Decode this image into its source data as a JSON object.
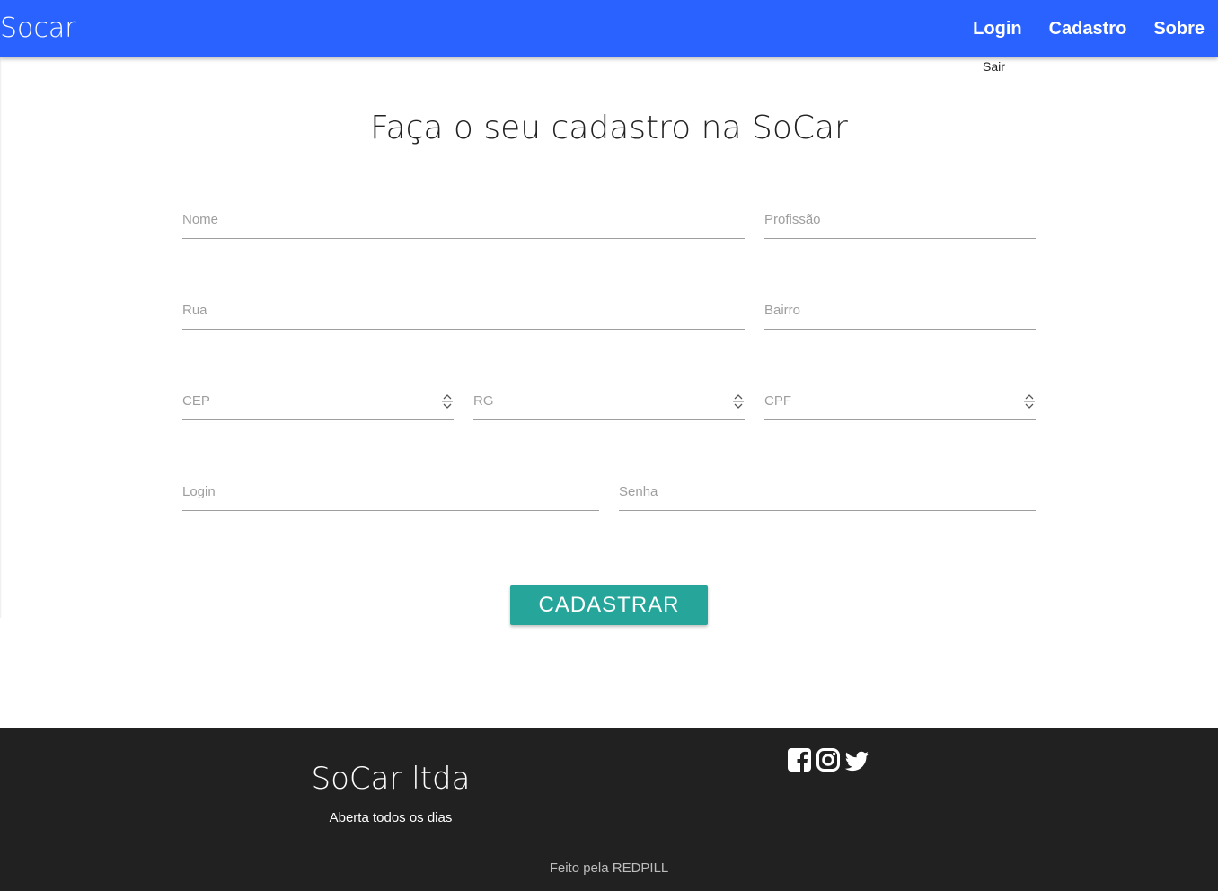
{
  "navbar": {
    "brand": "Socar",
    "links": [
      {
        "label": "Login"
      },
      {
        "label": "Cadastro"
      },
      {
        "label": "Sobre"
      }
    ],
    "logout": "Sair",
    "color": "#2962ff"
  },
  "form": {
    "title": "Faça o seu cadastro na SoCar",
    "fields": {
      "nome": {
        "placeholder": "Nome",
        "value": ""
      },
      "profissao": {
        "placeholder": "Profissão",
        "value": ""
      },
      "rua": {
        "placeholder": "Rua",
        "value": ""
      },
      "bairro": {
        "placeholder": "Bairro",
        "value": ""
      },
      "cep": {
        "placeholder": "CEP",
        "value": ""
      },
      "rg": {
        "placeholder": "RG",
        "value": ""
      },
      "cpf": {
        "placeholder": "CPF",
        "value": ""
      },
      "login": {
        "placeholder": "Login",
        "value": ""
      },
      "senha": {
        "placeholder": "Senha",
        "value": ""
      }
    },
    "submit_label": "CADASTRAR",
    "submit_color": "#26a69a"
  },
  "footer": {
    "company": "SoCar ltda",
    "hours": "Aberta todos os dias",
    "credit": "Feito pela REDPILL",
    "social_icons": [
      "facebook-icon",
      "instagram-icon",
      "twitter-icon"
    ],
    "background": "#212121"
  }
}
